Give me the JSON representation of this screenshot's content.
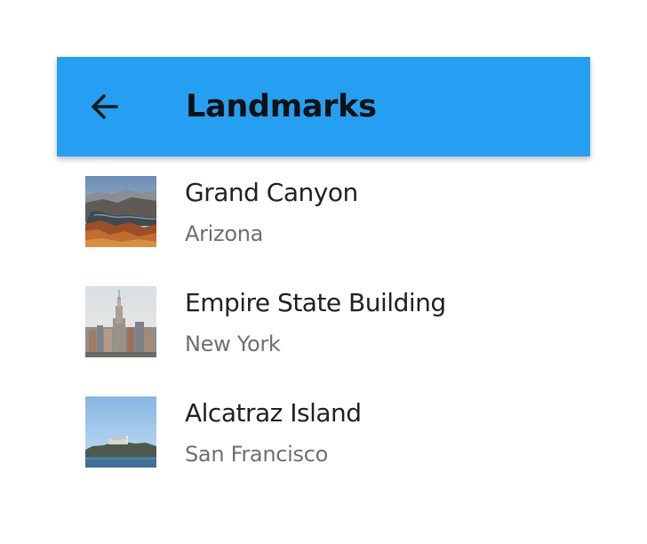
{
  "toolbar": {
    "title": "Landmarks",
    "back_icon": "arrow-back-icon",
    "color": "#249ff2"
  },
  "landmarks": [
    {
      "name": "Grand Canyon",
      "location": "Arizona",
      "image": "grand-canyon-photo"
    },
    {
      "name": "Empire State Building",
      "location": "New York",
      "image": "empire-state-building-photo"
    },
    {
      "name": "Alcatraz Island",
      "location": "San Francisco",
      "image": "alcatraz-island-photo"
    }
  ]
}
